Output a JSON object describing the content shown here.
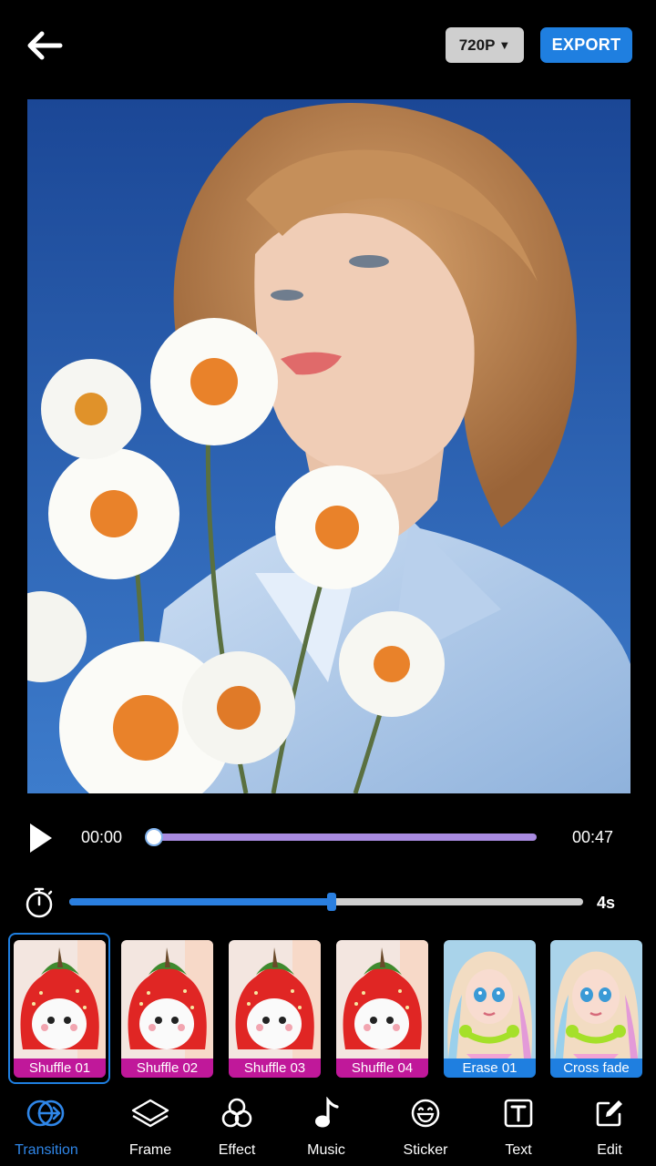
{
  "header": {
    "resolution_label": "720P",
    "export_label": "EXPORT"
  },
  "player": {
    "current_time": "00:00",
    "total_time": "00:47",
    "progress_fraction": 0.0
  },
  "duration": {
    "value_label": "4s",
    "level_fraction": 0.51
  },
  "transitions": [
    {
      "label": "Shuffle 01",
      "style": "pink",
      "art": "strawberry",
      "selected": true
    },
    {
      "label": "Shuffle 02",
      "style": "pink",
      "art": "strawberry",
      "selected": false
    },
    {
      "label": "Shuffle 03",
      "style": "pink",
      "art": "strawberry",
      "selected": false
    },
    {
      "label": "Shuffle 04",
      "style": "pink",
      "art": "strawberry",
      "selected": false
    },
    {
      "label": "Erase 01",
      "style": "blue",
      "art": "doll",
      "selected": false
    },
    {
      "label": "Cross fade",
      "style": "blue",
      "art": "doll",
      "selected": false
    }
  ],
  "nav": [
    {
      "label": "Transition",
      "icon": "transition-icon",
      "active": true
    },
    {
      "label": "Frame",
      "icon": "layers-icon",
      "active": false
    },
    {
      "label": "Effect",
      "icon": "effect-icon",
      "active": false
    },
    {
      "label": "Music",
      "icon": "music-note-icon",
      "active": false
    },
    {
      "label": "Sticker",
      "icon": "smiley-icon",
      "active": false
    },
    {
      "label": "Text",
      "icon": "text-box-icon",
      "active": false
    },
    {
      "label": "Edit",
      "icon": "edit-icon",
      "active": false
    }
  ],
  "colors": {
    "accent": "#1f7fe0",
    "progress": "#a98be0",
    "tag_pink": "#c0189a"
  }
}
